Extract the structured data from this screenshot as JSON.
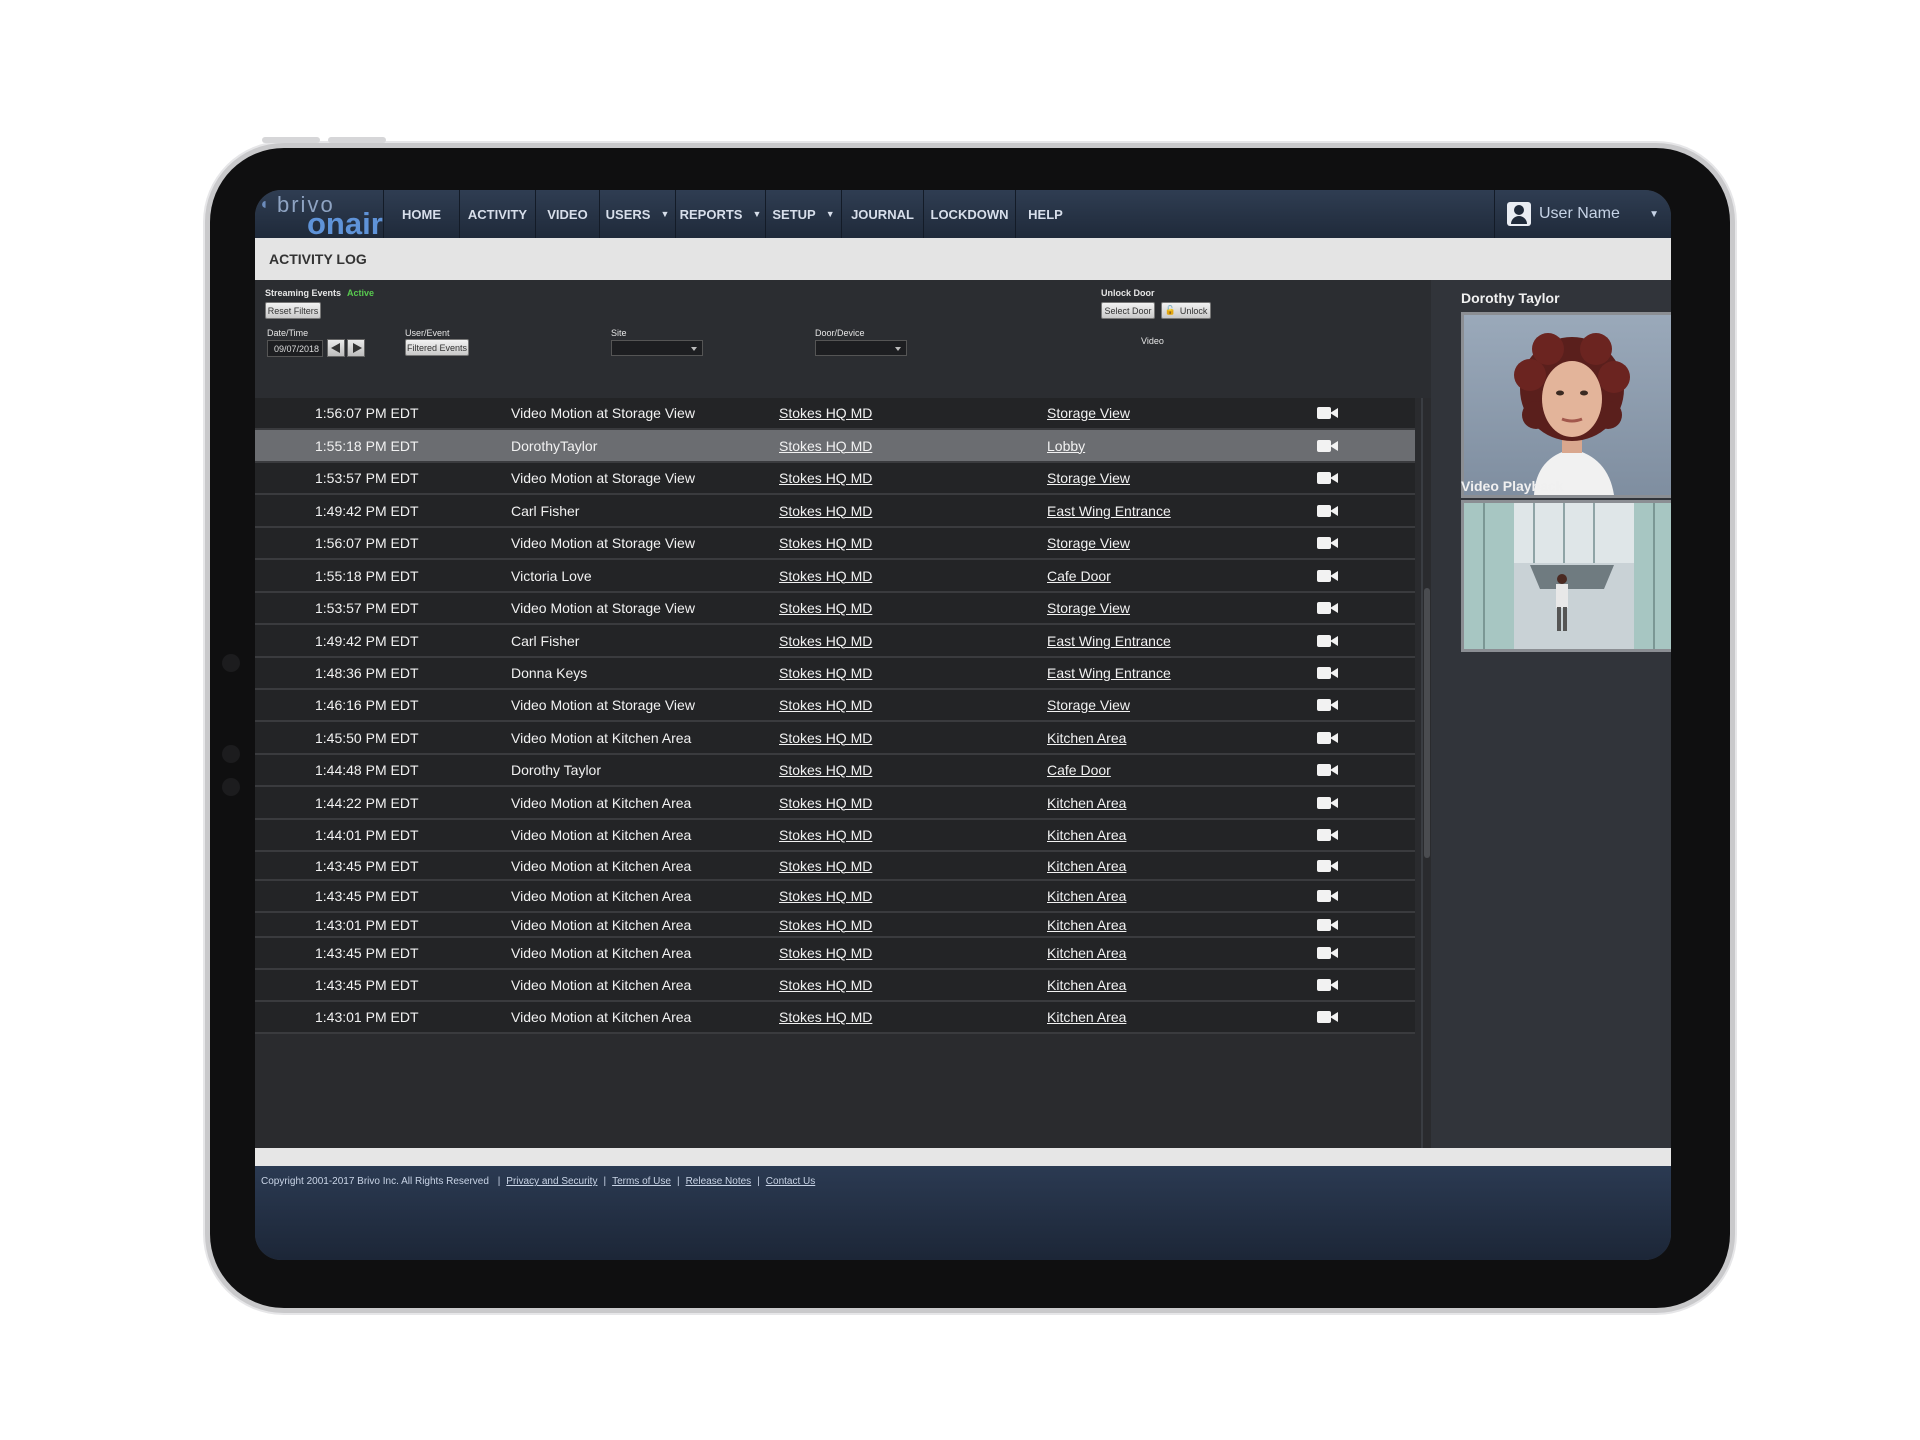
{
  "app": {
    "logo_top": "brivo",
    "logo_bottom": "onair"
  },
  "nav": {
    "items": [
      {
        "label": "HOME",
        "caret": false
      },
      {
        "label": "ACTIVITY",
        "caret": false
      },
      {
        "label": "VIDEO",
        "caret": false
      },
      {
        "label": "USERS",
        "caret": true
      },
      {
        "label": "REPORTS",
        "caret": true
      },
      {
        "label": "SETUP",
        "caret": true
      },
      {
        "label": "JOURNAL",
        "caret": false
      },
      {
        "label": "LOCKDOWN",
        "caret": false
      },
      {
        "label": "HELP",
        "caret": false
      }
    ],
    "user_name": "User Name"
  },
  "page": {
    "title": "ACTIVITY LOG"
  },
  "filters": {
    "streaming_label": "Streaming Events",
    "streaming_status": "Active",
    "reset_button": "Reset Filters",
    "date_label": "Date/Time",
    "date_value": "09/07/2018",
    "user_event_label": "User/Event",
    "filtered_events_button": "Filtered Events",
    "site_label": "Site",
    "door_device_label": "Door/Device",
    "unlock_door_label": "Unlock Door",
    "select_door_button": "Select Door",
    "unlock_button": "Unlock",
    "video_column_label": "Video"
  },
  "rows": [
    {
      "time": "1:56:07 PM EDT",
      "event": "Video Motion at Storage View",
      "site": "Stokes HQ MD",
      "door": "Storage View",
      "selected": false
    },
    {
      "time": "1:55:18 PM EDT",
      "event": "DorothyTaylor",
      "site": "Stokes HQ MD",
      "door": "Lobby",
      "selected": true
    },
    {
      "time": "1:53:57 PM EDT",
      "event": "Video Motion at Storage View",
      "site": "Stokes HQ MD",
      "door": "Storage View",
      "selected": false
    },
    {
      "time": "1:49:42 PM EDT",
      "event": "Carl Fisher",
      "site": "Stokes HQ MD",
      "door": "East Wing Entrance",
      "selected": false
    },
    {
      "time": "1:56:07 PM EDT",
      "event": "Video Motion at Storage View",
      "site": "Stokes HQ MD",
      "door": "Storage View",
      "selected": false
    },
    {
      "time": "1:55:18 PM EDT",
      "event": "Victoria Love",
      "site": "Stokes HQ MD",
      "door": "Cafe Door",
      "selected": false
    },
    {
      "time": "1:53:57 PM EDT",
      "event": "Video Motion at Storage View",
      "site": "Stokes HQ MD",
      "door": "Storage View",
      "selected": false
    },
    {
      "time": "1:49:42 PM EDT",
      "event": "Carl Fisher",
      "site": "Stokes HQ MD",
      "door": "East Wing Entrance",
      "selected": false
    },
    {
      "time": "1:48:36 PM EDT",
      "event": "Donna Keys",
      "site": "Stokes HQ MD",
      "door": "East Wing Entrance",
      "selected": false
    },
    {
      "time": "1:46:16 PM EDT",
      "event": "Video Motion at Storage View",
      "site": "Stokes HQ MD",
      "door": "Storage View",
      "selected": false
    },
    {
      "time": "1:45:50 PM EDT",
      "event": "Video Motion at Kitchen Area",
      "site": "Stokes HQ MD",
      "door": "Kitchen Area",
      "selected": false
    },
    {
      "time": "1:44:48 PM EDT",
      "event": "Dorothy Taylor",
      "site": "Stokes HQ MD",
      "door": "Cafe Door",
      "selected": false
    },
    {
      "time": "1:44:22 PM EDT",
      "event": "Video Motion at Kitchen Area",
      "site": "Stokes HQ MD",
      "door": "Kitchen Area",
      "selected": false
    },
    {
      "time": "1:44:01 PM EDT",
      "event": "Video Motion at Kitchen Area",
      "site": "Stokes HQ MD",
      "door": "Kitchen Area",
      "selected": false
    },
    {
      "time": "1:43:45 PM EDT",
      "event": "Video Motion at Kitchen Area",
      "site": "Stokes HQ MD",
      "door": "Kitchen Area",
      "selected": false
    },
    {
      "time": "1:43:45 PM EDT",
      "event": "Video Motion at Kitchen Area",
      "site": "Stokes HQ MD",
      "door": "Kitchen Area",
      "selected": false
    },
    {
      "time": "1:43:01 PM EDT",
      "event": "Video Motion at Kitchen Area",
      "site": "Stokes HQ MD",
      "door": "Kitchen Area",
      "selected": false
    },
    {
      "time": "1:43:45 PM EDT",
      "event": "Video Motion at Kitchen Area",
      "site": "Stokes HQ MD",
      "door": "Kitchen Area",
      "selected": false
    },
    {
      "time": "1:43:45 PM EDT",
      "event": "Video Motion at Kitchen Area",
      "site": "Stokes HQ MD",
      "door": "Kitchen Area",
      "selected": false
    },
    {
      "time": "1:43:01 PM EDT",
      "event": "Video Motion at Kitchen Area",
      "site": "Stokes HQ MD",
      "door": "Kitchen Area",
      "selected": false
    }
  ],
  "right_panel": {
    "person_name": "Dorothy Taylor",
    "video_label": "Video Playback"
  },
  "footer": {
    "copyright": "Copyright 2001-2017 Brivo Inc. All Rights Reserved",
    "links": [
      "Privacy and Security",
      "Terms of Use",
      "Release Notes",
      "Contact Us"
    ]
  },
  "colors": {
    "nav_bg": "#1f2a3a",
    "active_green": "#58c94f",
    "row_bg": "#232426",
    "row_selected": "#6b6d71"
  },
  "icons": {
    "camera": "video-camera-icon",
    "user": "user-icon",
    "arrows": [
      "arrow-left-icon",
      "arrow-right-icon"
    ],
    "lock": "unlock-icon"
  }
}
